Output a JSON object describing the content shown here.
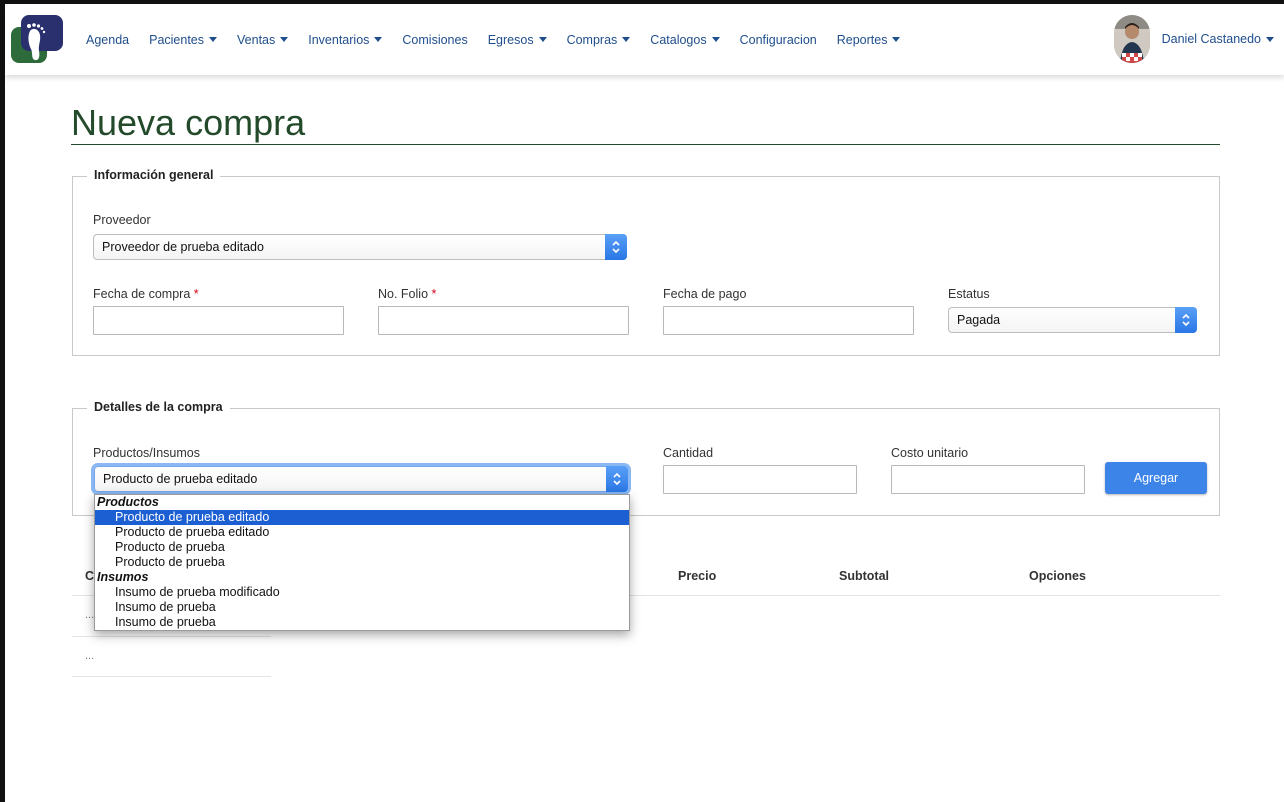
{
  "nav": {
    "items": [
      {
        "label": "Agenda",
        "dropdown": false
      },
      {
        "label": "Pacientes",
        "dropdown": true
      },
      {
        "label": "Ventas",
        "dropdown": true
      },
      {
        "label": "Inventarios",
        "dropdown": true
      },
      {
        "label": "Comisiones",
        "dropdown": false
      },
      {
        "label": "Egresos",
        "dropdown": true
      },
      {
        "label": "Compras",
        "dropdown": true
      },
      {
        "label": "Catalogos",
        "dropdown": true
      },
      {
        "label": "Configuracion",
        "dropdown": false
      },
      {
        "label": "Reportes",
        "dropdown": true
      }
    ],
    "user_name": "Daniel Castanedo",
    "accent_color": "#1f4e8c"
  },
  "page": {
    "title": "Nueva compra",
    "title_color": "#234a2a"
  },
  "general": {
    "legend": "Información general",
    "proveedor_label": "Proveedor",
    "proveedor_value": "Proveedor de prueba editado",
    "fecha_compra_label": "Fecha de compra",
    "folio_label": "No. Folio",
    "required_mark": "*",
    "fecha_pago_label": "Fecha de pago",
    "estatus_label": "Estatus",
    "estatus_value": "Pagada"
  },
  "details": {
    "legend": "Detalles de la compra",
    "productos_label": "Productos/Insumos",
    "productos_value": "Producto de prueba editado",
    "cantidad_label": "Cantidad",
    "costo_label": "Costo unitario",
    "agregar_label": "Agregar"
  },
  "table": {
    "headers": [
      "C",
      "Precio",
      "Subtotal",
      "Opciones"
    ],
    "rows": [
      "...",
      "..."
    ]
  },
  "dropdown": {
    "groups": [
      {
        "label": "Productos",
        "options": [
          "Producto de prueba editado",
          "Producto de prueba editado",
          "Producto de prueba",
          "Producto de prueba"
        ]
      },
      {
        "label": "Insumos",
        "options": [
          "Insumo de prueba modificado",
          "Insumo de prueba",
          "Insumo de prueba"
        ]
      }
    ],
    "selected_index": 0,
    "selected_color": "#1c5fd3"
  }
}
